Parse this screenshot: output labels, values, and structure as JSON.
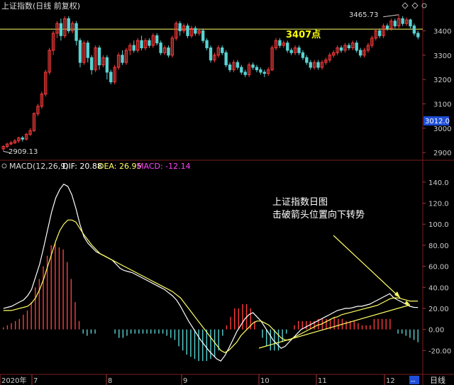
{
  "header": {
    "title": "上证指数(日线 前复权)",
    "macd_label": "MACD(12,26,9)",
    "dif_label": "DIF: 20.88",
    "dea_label": "DEA: 26.95",
    "macd_value_label": "MACD: -12.14",
    "period_label": "日线"
  },
  "price_panel": {
    "y_ticks": [
      "3400",
      "3300",
      "3200",
      "3100",
      "3000",
      "2900"
    ],
    "current_price_tag": "3012.0",
    "high_label": "3465.73",
    "low_label": "2909.13",
    "level_label": "3407点"
  },
  "macd_panel": {
    "y_ticks": [
      "140.0",
      "120.0",
      "100.0",
      "80.00",
      "60.00",
      "40.00",
      "20.00",
      "0.00",
      "-20.00"
    ],
    "annotation_line1": "上证指数日图",
    "annotation_line2": "击破箭头位置向下转势"
  },
  "dates": {
    "labels": [
      "2020年",
      "7",
      "8",
      "9",
      "10",
      "11",
      "12"
    ],
    "end_marker": "--"
  },
  "colors": {
    "background": "#000000",
    "up": "#ff3c3c",
    "down": "#5ad2d2",
    "dif_line": "#ffffff",
    "dea_line": "#ffff66",
    "level_line": "#ffff66",
    "level_text": "#ffff00",
    "macd_text": "#ff44ff",
    "annotation_text": "#ffffff"
  },
  "chart_data": {
    "type": "candlestick",
    "title": "上证指数(日线 前复权)",
    "price_ylim": [
      2880,
      3480
    ],
    "level_line": 3407,
    "candles": [
      [
        2915,
        2925,
        2905,
        2930
      ],
      [
        2925,
        2935,
        2918,
        2940
      ],
      [
        2935,
        2940,
        2930,
        2948
      ],
      [
        2940,
        2948,
        2935,
        2955
      ],
      [
        2948,
        2960,
        2940,
        2965
      ],
      [
        2960,
        2955,
        2945,
        2968
      ],
      [
        2955,
        2975,
        2950,
        2980
      ],
      [
        2975,
        2990,
        2968,
        3000
      ],
      [
        2990,
        3060,
        2985,
        3065
      ],
      [
        3060,
        3090,
        3050,
        3100
      ],
      [
        3090,
        3140,
        3080,
        3150
      ],
      [
        3140,
        3230,
        3130,
        3240
      ],
      [
        3230,
        3320,
        3220,
        3330
      ],
      [
        3320,
        3390,
        3300,
        3400
      ],
      [
        3390,
        3430,
        3370,
        3440
      ],
      [
        3430,
        3380,
        3360,
        3450
      ],
      [
        3380,
        3450,
        3370,
        3460
      ],
      [
        3450,
        3400,
        3390,
        3460
      ],
      [
        3400,
        3430,
        3390,
        3440
      ],
      [
        3430,
        3360,
        3340,
        3440
      ],
      [
        3360,
        3270,
        3250,
        3370
      ],
      [
        3270,
        3350,
        3260,
        3360
      ],
      [
        3350,
        3290,
        3270,
        3360
      ],
      [
        3290,
        3240,
        3220,
        3300
      ],
      [
        3240,
        3330,
        3230,
        3340
      ],
      [
        3330,
        3260,
        3240,
        3340
      ],
      [
        3260,
        3290,
        3250,
        3300
      ],
      [
        3290,
        3230,
        3200,
        3300
      ],
      [
        3230,
        3190,
        3180,
        3240
      ],
      [
        3190,
        3250,
        3180,
        3260
      ],
      [
        3250,
        3300,
        3240,
        3310
      ],
      [
        3300,
        3270,
        3260,
        3320
      ],
      [
        3270,
        3320,
        3260,
        3330
      ],
      [
        3320,
        3340,
        3300,
        3350
      ],
      [
        3340,
        3320,
        3310,
        3360
      ],
      [
        3320,
        3360,
        3310,
        3370
      ],
      [
        3360,
        3330,
        3320,
        3380
      ],
      [
        3330,
        3360,
        3320,
        3370
      ],
      [
        3360,
        3340,
        3330,
        3370
      ],
      [
        3340,
        3380,
        3330,
        3390
      ],
      [
        3380,
        3350,
        3340,
        3390
      ],
      [
        3350,
        3310,
        3300,
        3360
      ],
      [
        3310,
        3330,
        3300,
        3340
      ],
      [
        3330,
        3300,
        3290,
        3340
      ],
      [
        3300,
        3370,
        3290,
        3380
      ],
      [
        3370,
        3430,
        3360,
        3440
      ],
      [
        3430,
        3400,
        3380,
        3440
      ],
      [
        3400,
        3420,
        3390,
        3430
      ],
      [
        3420,
        3380,
        3370,
        3430
      ],
      [
        3380,
        3410,
        3370,
        3420
      ],
      [
        3410,
        3390,
        3380,
        3420
      ],
      [
        3390,
        3400,
        3380,
        3410
      ],
      [
        3400,
        3360,
        3350,
        3410
      ],
      [
        3360,
        3330,
        3320,
        3370
      ],
      [
        3330,
        3280,
        3270,
        3340
      ],
      [
        3280,
        3300,
        3270,
        3310
      ],
      [
        3300,
        3330,
        3290,
        3340
      ],
      [
        3330,
        3310,
        3300,
        3340
      ],
      [
        3310,
        3260,
        3250,
        3320
      ],
      [
        3260,
        3240,
        3230,
        3270
      ],
      [
        3240,
        3270,
        3230,
        3280
      ],
      [
        3270,
        3250,
        3240,
        3280
      ],
      [
        3250,
        3230,
        3220,
        3260
      ],
      [
        3230,
        3220,
        3210,
        3240
      ],
      [
        3220,
        3260,
        3210,
        3270
      ],
      [
        3260,
        3250,
        3240,
        3270
      ],
      [
        3250,
        3240,
        3230,
        3260
      ],
      [
        3240,
        3230,
        3220,
        3250
      ],
      [
        3230,
        3225,
        3210,
        3240
      ],
      [
        3225,
        3240,
        3215,
        3250
      ],
      [
        3240,
        3330,
        3235,
        3340
      ],
      [
        3330,
        3360,
        3320,
        3370
      ],
      [
        3360,
        3340,
        3330,
        3370
      ],
      [
        3340,
        3350,
        3330,
        3360
      ],
      [
        3350,
        3320,
        3310,
        3360
      ],
      [
        3320,
        3310,
        3300,
        3330
      ],
      [
        3310,
        3330,
        3300,
        3340
      ],
      [
        3330,
        3310,
        3300,
        3340
      ],
      [
        3310,
        3290,
        3280,
        3320
      ],
      [
        3290,
        3270,
        3260,
        3300
      ],
      [
        3270,
        3250,
        3240,
        3280
      ],
      [
        3250,
        3270,
        3240,
        3280
      ],
      [
        3270,
        3250,
        3240,
        3280
      ],
      [
        3250,
        3270,
        3240,
        3280
      ],
      [
        3270,
        3280,
        3260,
        3290
      ],
      [
        3280,
        3300,
        3270,
        3310
      ],
      [
        3300,
        3310,
        3290,
        3320
      ],
      [
        3310,
        3330,
        3300,
        3340
      ],
      [
        3330,
        3320,
        3310,
        3340
      ],
      [
        3320,
        3340,
        3310,
        3350
      ],
      [
        3340,
        3330,
        3320,
        3350
      ],
      [
        3330,
        3350,
        3320,
        3360
      ],
      [
        3350,
        3320,
        3310,
        3360
      ],
      [
        3320,
        3300,
        3290,
        3330
      ],
      [
        3300,
        3320,
        3290,
        3330
      ],
      [
        3320,
        3340,
        3310,
        3350
      ],
      [
        3340,
        3370,
        3330,
        3380
      ],
      [
        3370,
        3400,
        3360,
        3410
      ],
      [
        3400,
        3380,
        3370,
        3410
      ],
      [
        3380,
        3420,
        3370,
        3430
      ],
      [
        3420,
        3410,
        3400,
        3430
      ],
      [
        3410,
        3440,
        3400,
        3450
      ],
      [
        3440,
        3420,
        3410,
        3450
      ],
      [
        3420,
        3450,
        3410,
        3466
      ],
      [
        3450,
        3430,
        3420,
        3460
      ],
      [
        3430,
        3445,
        3420,
        3455
      ],
      [
        3445,
        3420,
        3410,
        3450
      ],
      [
        3420,
        3390,
        3380,
        3430
      ],
      [
        3390,
        3375,
        3365,
        3400
      ]
    ],
    "macd_ylim": [
      -40,
      150
    ],
    "macd_series": [
      {
        "name": "DIF",
        "label": "DIF: 20.88"
      },
      {
        "name": "DEA",
        "label": "DEA: 26.95"
      },
      {
        "name": "MACD",
        "label": "MACD: -12.14"
      }
    ],
    "dif": [
      20,
      21,
      22,
      24,
      26,
      28,
      32,
      38,
      50,
      62,
      78,
      95,
      112,
      125,
      133,
      138,
      136,
      128,
      115,
      100,
      88,
      82,
      78,
      74,
      72,
      70,
      68,
      66,
      62,
      58,
      56,
      55,
      54,
      52,
      50,
      48,
      46,
      44,
      42,
      40,
      38,
      35,
      32,
      28,
      22,
      15,
      8,
      2,
      -4,
      -10,
      -15,
      -20,
      -24,
      -28,
      -30,
      -25,
      -18,
      -10,
      -2,
      4,
      10,
      14,
      16,
      12,
      8,
      2,
      -4,
      -10,
      -14,
      -18,
      -16,
      -12,
      -8,
      -4,
      0,
      2,
      4,
      6,
      8,
      10,
      12,
      14,
      16,
      18,
      19,
      20,
      20,
      21,
      22,
      22,
      23,
      24,
      26,
      28,
      30,
      32,
      34,
      30,
      28,
      26,
      24,
      22,
      21,
      20.88
    ],
    "dea": [
      18,
      18,
      18,
      19,
      20,
      21,
      22,
      25,
      30,
      38,
      48,
      60,
      72,
      84,
      94,
      100,
      104,
      104,
      102,
      96,
      90,
      85,
      80,
      76,
      72,
      70,
      68,
      66,
      64,
      62,
      60,
      58,
      56,
      54,
      52,
      50,
      48,
      46,
      44,
      42,
      40,
      38,
      36,
      33,
      30,
      25,
      20,
      15,
      10,
      5,
      0,
      -5,
      -10,
      -15,
      -20,
      -22,
      -20,
      -16,
      -12,
      -6,
      -2,
      2,
      6,
      8,
      8,
      6,
      4,
      0,
      -4,
      -8,
      -10,
      -10,
      -8,
      -6,
      -4,
      -2,
      0,
      2,
      4,
      5,
      7,
      9,
      11,
      12,
      14,
      15,
      16,
      17,
      18,
      19,
      20,
      21,
      22,
      23,
      25,
      27,
      29,
      30,
      30,
      29,
      28,
      27,
      27,
      26.95
    ],
    "macd_bars": [
      2,
      4,
      6,
      8,
      10,
      14,
      18,
      26,
      40,
      48,
      60,
      70,
      80,
      82,
      78,
      76,
      64,
      48,
      26,
      8,
      -4,
      -6,
      -4,
      -4,
      0,
      0,
      0,
      0,
      -4,
      -8,
      -8,
      -6,
      -4,
      -4,
      -4,
      -4,
      -4,
      -4,
      -4,
      -4,
      -4,
      -6,
      -8,
      -10,
      -16,
      -20,
      -24,
      -26,
      -28,
      -30,
      -30,
      -30,
      -28,
      -26,
      -20,
      -6,
      4,
      12,
      20,
      20,
      24,
      24,
      20,
      8,
      0,
      -8,
      -16,
      -20,
      -20,
      -20,
      -12,
      -4,
      0,
      4,
      8,
      8,
      8,
      8,
      8,
      10,
      10,
      10,
      10,
      12,
      10,
      10,
      8,
      8,
      8,
      6,
      4,
      4,
      4,
      10,
      10,
      10,
      10,
      10,
      0,
      -4,
      -4,
      -6,
      -8,
      -10,
      -12.14
    ]
  }
}
